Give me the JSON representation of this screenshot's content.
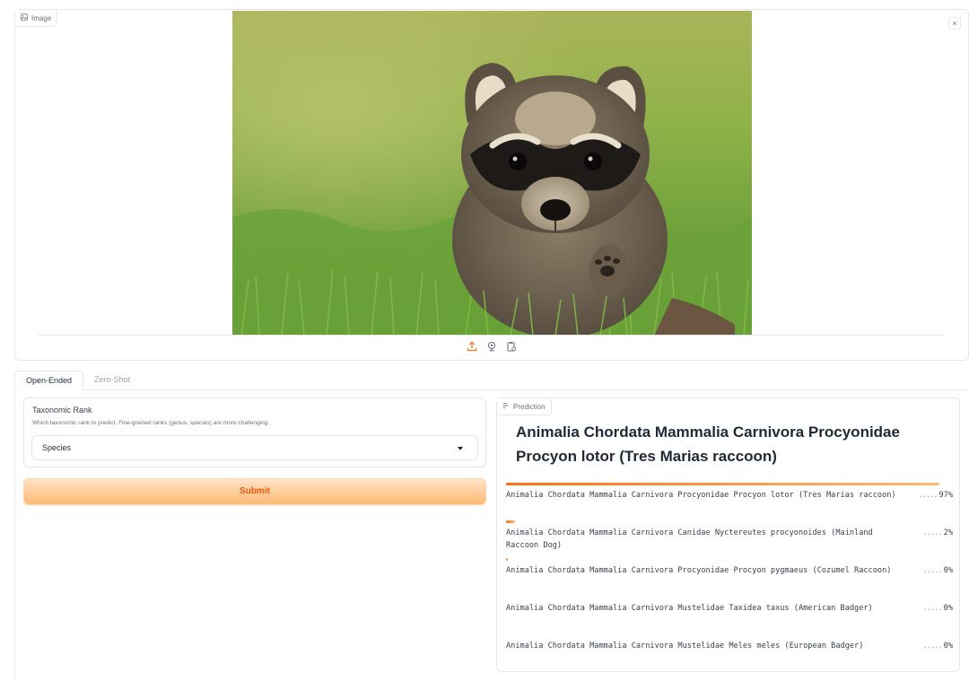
{
  "image_panel": {
    "label": "Image",
    "close_symbol": "×",
    "icons": [
      "image-icon",
      "upload-icon",
      "webcam-icon",
      "clipboard-icon",
      "close-icon"
    ],
    "photo_description_icon": "raccoon-photo"
  },
  "tabs": [
    {
      "label": "Open-Ended",
      "active": true
    },
    {
      "label": "Zero-Shot",
      "active": false
    }
  ],
  "rank": {
    "label": "Taxonomic Rank",
    "info": "Which taxonomic rank to predict. Fine-grained ranks (genus, species) are more challenging.",
    "selected": "Species"
  },
  "submit_label": "Submit",
  "prediction": {
    "label": "Prediction",
    "title": "Animalia Chordata Mammalia Carnivora Procyonidae Procyon lotor (Tres Marias raccoon)",
    "items": [
      {
        "name": "Animalia Chordata Mammalia Carnivora Procyonidae Procyon lotor (Tres Marias raccoon)",
        "confidence": "97%",
        "fraction": 0.97
      },
      {
        "name": "Animalia Chordata Mammalia Carnivora Canidae Nyctereutes procyonoides (Mainland Raccoon Dog)",
        "confidence": "2%",
        "fraction": 0.02
      },
      {
        "name": "Animalia Chordata Mammalia Carnivora Procyonidae Procyon pygmaeus (Cozumel Raccoon)",
        "confidence": "0%",
        "fraction": 0.003
      },
      {
        "name": "Animalia Chordata Mammalia Carnivora Mustelidae Taxidea taxus (American Badger)",
        "confidence": "0%",
        "fraction": 0
      },
      {
        "name": "Animalia Chordata Mammalia Carnivora Mustelidae Meles meles (European Badger)",
        "confidence": "0%",
        "fraction": 0
      }
    ]
  },
  "colors": {
    "accent": "#f97316",
    "submit_text": "#ea580c",
    "border": "#e5e7eb"
  }
}
